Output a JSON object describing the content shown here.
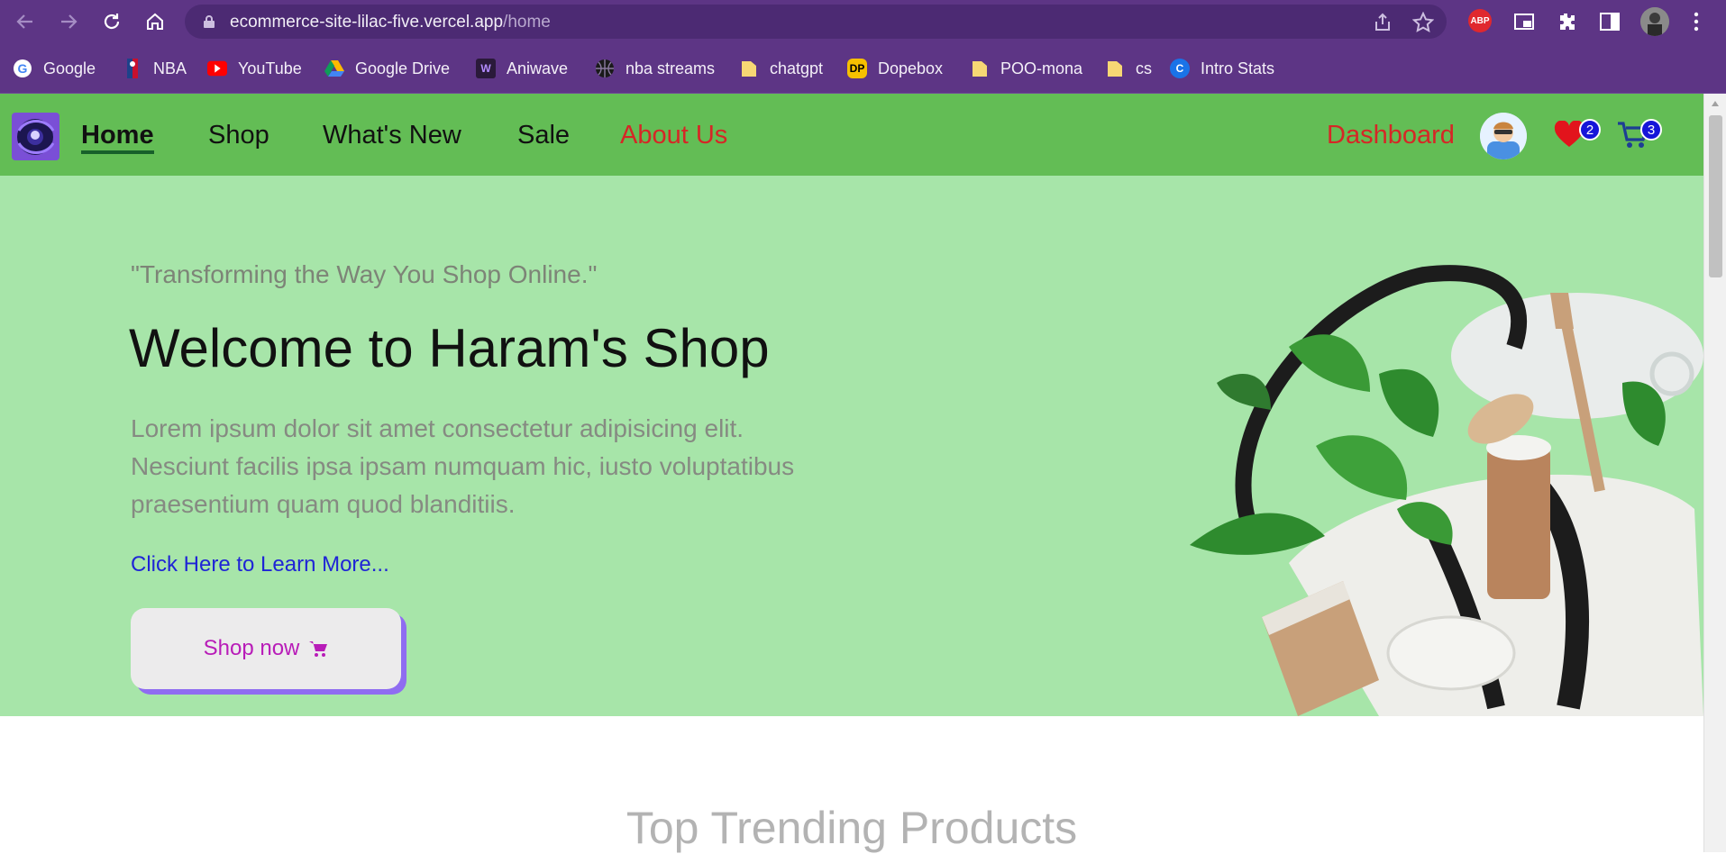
{
  "browser": {
    "url_host": "ecommerce-site-lilac-five.vercel.app",
    "url_path": "/home",
    "extension_abp": "ABP",
    "bookmarks": [
      {
        "label": "Google",
        "icon": "google-icon"
      },
      {
        "label": "NBA",
        "icon": "nba-icon"
      },
      {
        "label": "YouTube",
        "icon": "youtube-icon"
      },
      {
        "label": "Google Drive",
        "icon": "drive-icon"
      },
      {
        "label": "Aniwave",
        "icon": "aniwave-icon"
      },
      {
        "label": "nba streams",
        "icon": "basketball-icon"
      },
      {
        "label": "chatgpt",
        "icon": "folder-icon"
      },
      {
        "label": "Dopebox",
        "icon": "dopebox-icon"
      },
      {
        "label": "POO-mona",
        "icon": "folder-icon"
      },
      {
        "label": "cs",
        "icon": "folder-icon"
      },
      {
        "label": "Intro Stats",
        "icon": "intro-stats-icon"
      }
    ],
    "bookmark_icon_text": {
      "dopebox": "DP",
      "intro_stats": "C",
      "aniwave": "W"
    }
  },
  "nav": {
    "home": "Home",
    "shop": "Shop",
    "whats_new": "What's New",
    "sale": "Sale",
    "about": "About Us",
    "dashboard": "Dashboard",
    "wishlist_count": "2",
    "cart_count": "3"
  },
  "hero": {
    "tagline": "\"Transforming the Way You Shop Online.\"",
    "title": "Welcome to Haram's Shop",
    "body": "Lorem ipsum dolor sit amet consectetur adipisicing elit. Nesciunt facilis ipsa ipsam numquam hic, iusto voluptatibus praesentium quam quod blanditiis.",
    "learn_more": "Click Here to Learn More...",
    "shop_now": "Shop now"
  },
  "section": {
    "title": "Top Trending Products"
  },
  "colors": {
    "browser_frame": "#5d3585",
    "navbar": "#63bd55",
    "hero_bg": "#a7e5a9",
    "about_link": "#d62626",
    "link": "#1f24d6",
    "button_text": "#b81cb8",
    "button_shadow": "#8f6cf1",
    "badge": "#1515d9"
  }
}
